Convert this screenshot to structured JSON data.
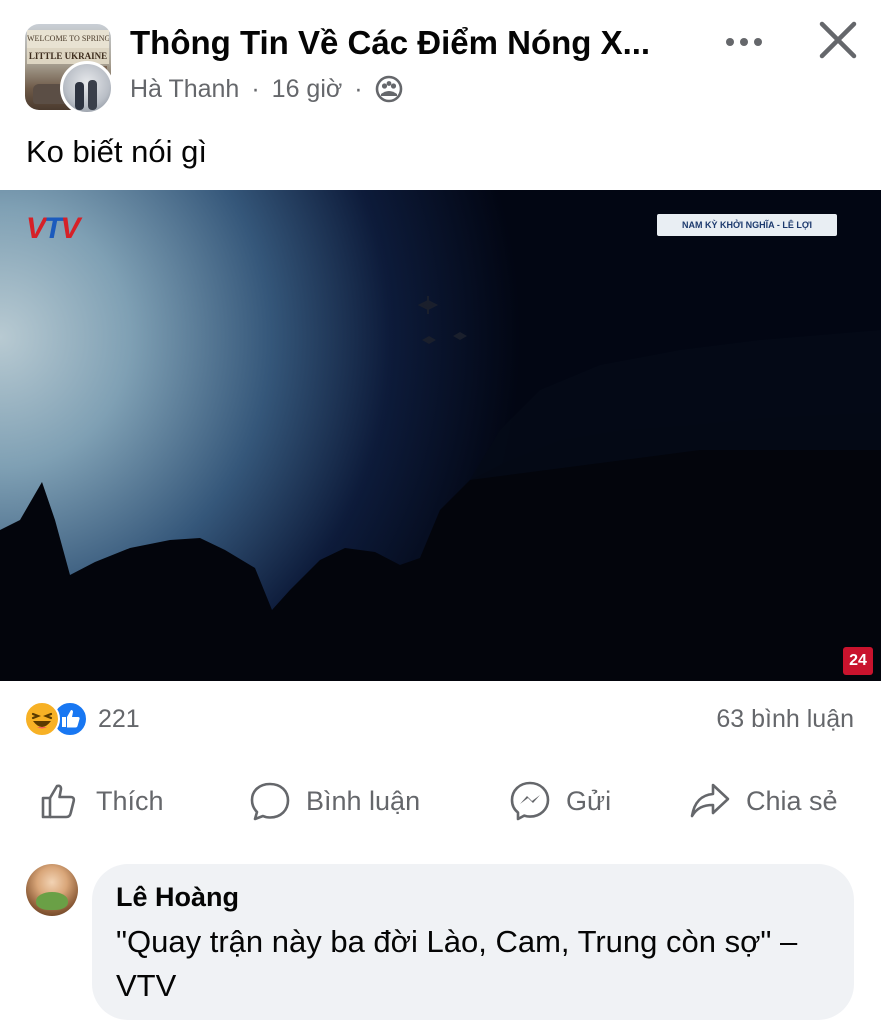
{
  "post": {
    "group_title": "Thông Tin Về Các Điểm Nóng X...",
    "group_avatar_text_line1": "WELCOME TO SPRINGFIELD",
    "group_avatar_text_line2": "LITTLE UKRAINE",
    "author": "Hà Thanh",
    "separator": "·",
    "time": "16 giờ",
    "audience_icon": "group-icon",
    "caption": "Ko biết nói gì"
  },
  "video": {
    "channel_logo": {
      "v1": "V",
      "t": "T",
      "v2": "V"
    },
    "banner": "NAM KỲ KHỞI NGHĨA - LÊ LỢI",
    "badge": "24"
  },
  "reactions": {
    "count": "221",
    "comments": "63 bình luận",
    "icons": [
      "haha-icon",
      "like-icon"
    ]
  },
  "actions": {
    "like": "Thích",
    "comment": "Bình luận",
    "send": "Gửi",
    "share": "Chia sẻ"
  },
  "comment": {
    "author": "Lê Hoàng",
    "text": "\"Quay trận này ba đời Lào, Cam, Trung còn sợ\" – VTV"
  },
  "colors": {
    "text_primary": "#050505",
    "text_secondary": "#65676b",
    "like_blue": "#1877f2",
    "haha_yellow": "#f7b125",
    "comment_bg": "#f0f2f5"
  }
}
